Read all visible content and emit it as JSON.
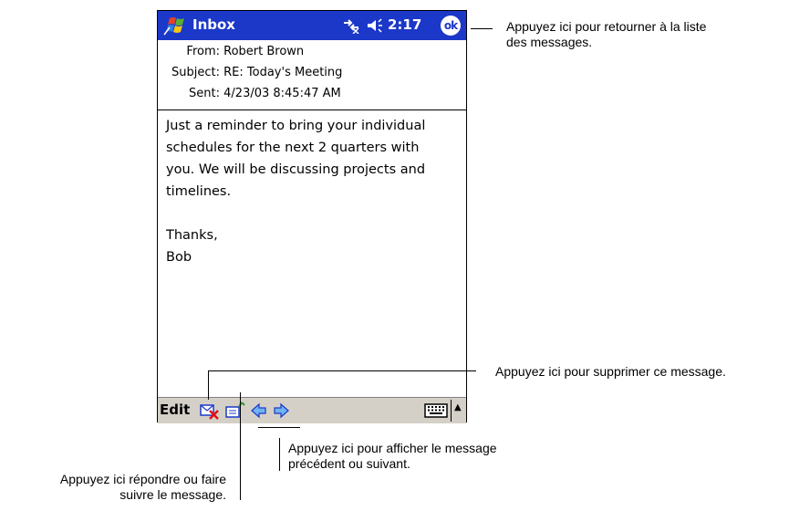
{
  "titlebar": {
    "title": "Inbox",
    "time": "2:17",
    "ok_label": "ok",
    "colors": {
      "bar": "#1c38c8",
      "text": "#ffffff"
    }
  },
  "message": {
    "from_label": "From:",
    "from_value": "Robert Brown",
    "subject_label": "Subject:",
    "subject_value": "RE: Today's Meeting",
    "sent_label": "Sent:",
    "sent_value": "4/23/03 8:45:47 AM",
    "body": "Just a reminder to bring your individual\nschedules for the next 2 quarters with\nyou. We will be discussing projects and\ntimelines.\n\nThanks,\nBob"
  },
  "toolbar": {
    "edit_label": "Edit",
    "icons": [
      "delete-icon",
      "reply-icon",
      "previous-arrow-icon",
      "next-arrow-icon",
      "keyboard-icon",
      "sip-arrow-icon"
    ]
  },
  "callouts": {
    "ok": "Appuyez ici pour retourner à la liste\ndes messages.",
    "delete": "Appuyez ici pour supprimer ce message.",
    "navigate": "Appuyez ici pour afficher le message\nprécédent ou suivant.",
    "reply": "Appuyez ici répondre ou faire\nsuivre le message."
  }
}
